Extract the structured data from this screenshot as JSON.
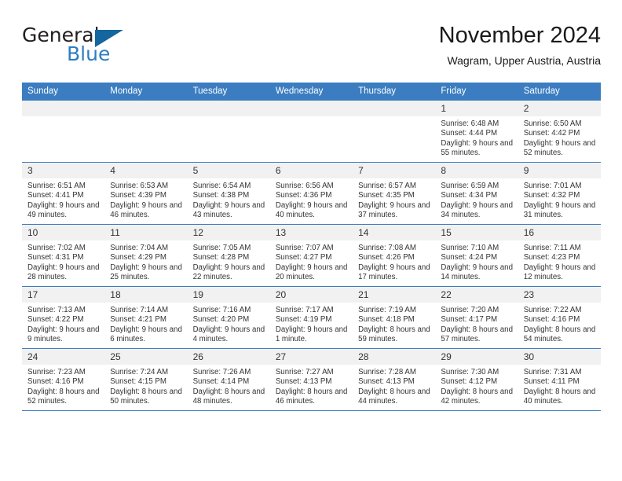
{
  "brand": {
    "name_top": "General",
    "name_bottom": "Blue",
    "triangle_color": "#15659f",
    "blue_color": "#2f7dc0"
  },
  "header": {
    "title": "November 2024",
    "subtitle": "Wagram, Upper Austria, Austria"
  },
  "theme": {
    "header_row_bg": "#3b7dc0",
    "daynum_bg": "#f1f1f1",
    "grid_line": "#3b7dc0",
    "text": "#333333"
  },
  "weekdays": [
    "Sunday",
    "Monday",
    "Tuesday",
    "Wednesday",
    "Thursday",
    "Friday",
    "Saturday"
  ],
  "weeks": [
    [
      {
        "day": "",
        "blank": true
      },
      {
        "day": "",
        "blank": true
      },
      {
        "day": "",
        "blank": true
      },
      {
        "day": "",
        "blank": true
      },
      {
        "day": "",
        "blank": true
      },
      {
        "day": "1",
        "sunrise": "Sunrise: 6:48 AM",
        "sunset": "Sunset: 4:44 PM",
        "daylight": "Daylight: 9 hours and 55 minutes."
      },
      {
        "day": "2",
        "sunrise": "Sunrise: 6:50 AM",
        "sunset": "Sunset: 4:42 PM",
        "daylight": "Daylight: 9 hours and 52 minutes."
      }
    ],
    [
      {
        "day": "3",
        "sunrise": "Sunrise: 6:51 AM",
        "sunset": "Sunset: 4:41 PM",
        "daylight": "Daylight: 9 hours and 49 minutes."
      },
      {
        "day": "4",
        "sunrise": "Sunrise: 6:53 AM",
        "sunset": "Sunset: 4:39 PM",
        "daylight": "Daylight: 9 hours and 46 minutes."
      },
      {
        "day": "5",
        "sunrise": "Sunrise: 6:54 AM",
        "sunset": "Sunset: 4:38 PM",
        "daylight": "Daylight: 9 hours and 43 minutes."
      },
      {
        "day": "6",
        "sunrise": "Sunrise: 6:56 AM",
        "sunset": "Sunset: 4:36 PM",
        "daylight": "Daylight: 9 hours and 40 minutes."
      },
      {
        "day": "7",
        "sunrise": "Sunrise: 6:57 AM",
        "sunset": "Sunset: 4:35 PM",
        "daylight": "Daylight: 9 hours and 37 minutes."
      },
      {
        "day": "8",
        "sunrise": "Sunrise: 6:59 AM",
        "sunset": "Sunset: 4:34 PM",
        "daylight": "Daylight: 9 hours and 34 minutes."
      },
      {
        "day": "9",
        "sunrise": "Sunrise: 7:01 AM",
        "sunset": "Sunset: 4:32 PM",
        "daylight": "Daylight: 9 hours and 31 minutes."
      }
    ],
    [
      {
        "day": "10",
        "sunrise": "Sunrise: 7:02 AM",
        "sunset": "Sunset: 4:31 PM",
        "daylight": "Daylight: 9 hours and 28 minutes."
      },
      {
        "day": "11",
        "sunrise": "Sunrise: 7:04 AM",
        "sunset": "Sunset: 4:29 PM",
        "daylight": "Daylight: 9 hours and 25 minutes."
      },
      {
        "day": "12",
        "sunrise": "Sunrise: 7:05 AM",
        "sunset": "Sunset: 4:28 PM",
        "daylight": "Daylight: 9 hours and 22 minutes."
      },
      {
        "day": "13",
        "sunrise": "Sunrise: 7:07 AM",
        "sunset": "Sunset: 4:27 PM",
        "daylight": "Daylight: 9 hours and 20 minutes."
      },
      {
        "day": "14",
        "sunrise": "Sunrise: 7:08 AM",
        "sunset": "Sunset: 4:26 PM",
        "daylight": "Daylight: 9 hours and 17 minutes."
      },
      {
        "day": "15",
        "sunrise": "Sunrise: 7:10 AM",
        "sunset": "Sunset: 4:24 PM",
        "daylight": "Daylight: 9 hours and 14 minutes."
      },
      {
        "day": "16",
        "sunrise": "Sunrise: 7:11 AM",
        "sunset": "Sunset: 4:23 PM",
        "daylight": "Daylight: 9 hours and 12 minutes."
      }
    ],
    [
      {
        "day": "17",
        "sunrise": "Sunrise: 7:13 AM",
        "sunset": "Sunset: 4:22 PM",
        "daylight": "Daylight: 9 hours and 9 minutes."
      },
      {
        "day": "18",
        "sunrise": "Sunrise: 7:14 AM",
        "sunset": "Sunset: 4:21 PM",
        "daylight": "Daylight: 9 hours and 6 minutes."
      },
      {
        "day": "19",
        "sunrise": "Sunrise: 7:16 AM",
        "sunset": "Sunset: 4:20 PM",
        "daylight": "Daylight: 9 hours and 4 minutes."
      },
      {
        "day": "20",
        "sunrise": "Sunrise: 7:17 AM",
        "sunset": "Sunset: 4:19 PM",
        "daylight": "Daylight: 9 hours and 1 minute."
      },
      {
        "day": "21",
        "sunrise": "Sunrise: 7:19 AM",
        "sunset": "Sunset: 4:18 PM",
        "daylight": "Daylight: 8 hours and 59 minutes."
      },
      {
        "day": "22",
        "sunrise": "Sunrise: 7:20 AM",
        "sunset": "Sunset: 4:17 PM",
        "daylight": "Daylight: 8 hours and 57 minutes."
      },
      {
        "day": "23",
        "sunrise": "Sunrise: 7:22 AM",
        "sunset": "Sunset: 4:16 PM",
        "daylight": "Daylight: 8 hours and 54 minutes."
      }
    ],
    [
      {
        "day": "24",
        "sunrise": "Sunrise: 7:23 AM",
        "sunset": "Sunset: 4:16 PM",
        "daylight": "Daylight: 8 hours and 52 minutes."
      },
      {
        "day": "25",
        "sunrise": "Sunrise: 7:24 AM",
        "sunset": "Sunset: 4:15 PM",
        "daylight": "Daylight: 8 hours and 50 minutes."
      },
      {
        "day": "26",
        "sunrise": "Sunrise: 7:26 AM",
        "sunset": "Sunset: 4:14 PM",
        "daylight": "Daylight: 8 hours and 48 minutes."
      },
      {
        "day": "27",
        "sunrise": "Sunrise: 7:27 AM",
        "sunset": "Sunset: 4:13 PM",
        "daylight": "Daylight: 8 hours and 46 minutes."
      },
      {
        "day": "28",
        "sunrise": "Sunrise: 7:28 AM",
        "sunset": "Sunset: 4:13 PM",
        "daylight": "Daylight: 8 hours and 44 minutes."
      },
      {
        "day": "29",
        "sunrise": "Sunrise: 7:30 AM",
        "sunset": "Sunset: 4:12 PM",
        "daylight": "Daylight: 8 hours and 42 minutes."
      },
      {
        "day": "30",
        "sunrise": "Sunrise: 7:31 AM",
        "sunset": "Sunset: 4:11 PM",
        "daylight": "Daylight: 8 hours and 40 minutes."
      }
    ]
  ]
}
